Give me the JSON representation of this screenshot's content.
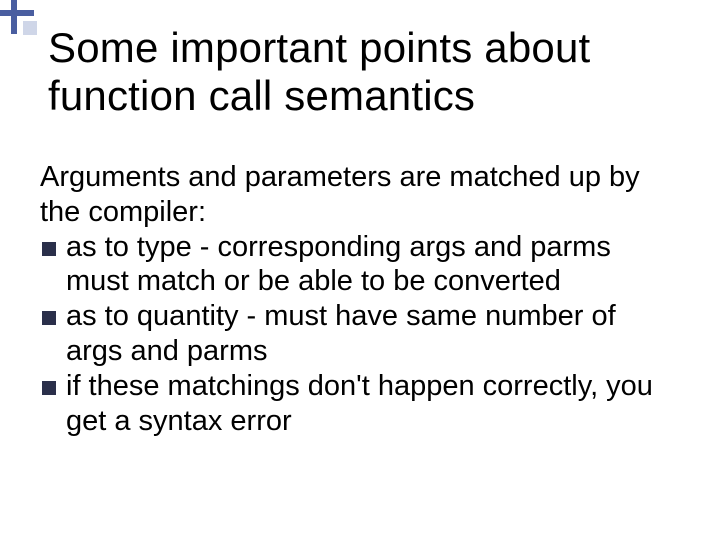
{
  "slide": {
    "title": "Some important points about function call semantics",
    "intro": "Arguments and parameters are matched up by the compiler:",
    "bullets": [
      "as to type - corresponding args and parms must match or be able to be converted",
      "as to quantity - must have same number of args and parms",
      "if these matchings don't happen correctly, you get a syntax error"
    ]
  }
}
